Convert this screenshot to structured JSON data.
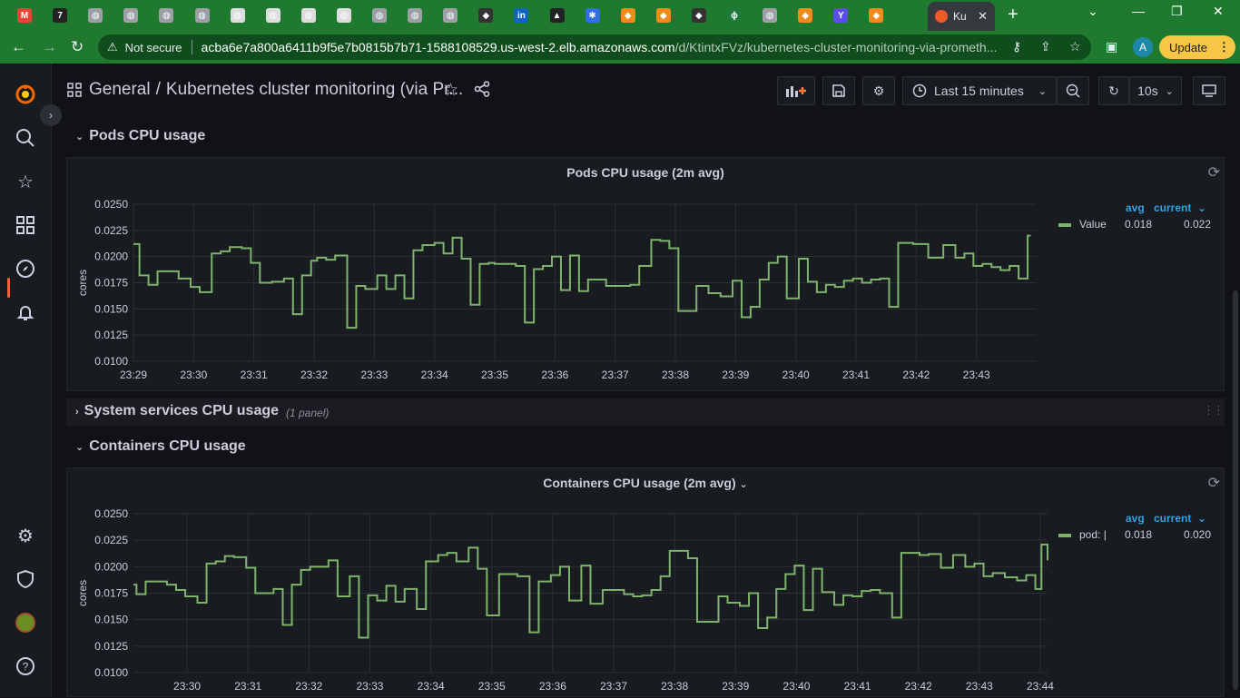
{
  "browser": {
    "tabs": [
      {
        "icon": "gmail-icon",
        "color": "#ea4335",
        "glyph": "M"
      },
      {
        "icon": "seven-icon",
        "color": "#222222",
        "glyph": "7"
      },
      {
        "icon": "globe-icon",
        "color": "#9aa0a6",
        "glyph": "◍"
      },
      {
        "icon": "globe-icon",
        "color": "#9aa0a6",
        "glyph": "◍"
      },
      {
        "icon": "globe-icon",
        "color": "#9aa0a6",
        "glyph": "◍"
      },
      {
        "icon": "globe-icon",
        "color": "#9aa0a6",
        "glyph": "◍"
      },
      {
        "icon": "globe-icon",
        "color": "#dddddd",
        "glyph": "◍"
      },
      {
        "icon": "globe-icon",
        "color": "#dddddd",
        "glyph": "◍"
      },
      {
        "icon": "globe-icon",
        "color": "#dddddd",
        "glyph": "◍"
      },
      {
        "icon": "globe-icon",
        "color": "#dddddd",
        "glyph": "◍"
      },
      {
        "icon": "globe-icon",
        "color": "#9aa0a6",
        "glyph": "◍"
      },
      {
        "icon": "globe-icon",
        "color": "#9aa0a6",
        "glyph": "◍"
      },
      {
        "icon": "globe-icon",
        "color": "#9aa0a6",
        "glyph": "◍"
      },
      {
        "icon": "cube-icon",
        "color": "#333333",
        "glyph": "◆"
      },
      {
        "icon": "linkedin-icon",
        "color": "#0a66c2",
        "glyph": "in"
      },
      {
        "icon": "grad-cap-icon",
        "color": "#222222",
        "glyph": "▲"
      },
      {
        "icon": "gear-logo-icon",
        "color": "#2f6fdf",
        "glyph": "✱"
      },
      {
        "icon": "aws-orange-icon",
        "color": "#f08c1a",
        "glyph": "◆"
      },
      {
        "icon": "aws-orange-icon",
        "color": "#f08c1a",
        "glyph": "◆"
      },
      {
        "icon": "cube-icon",
        "color": "#333333",
        "glyph": "◆"
      },
      {
        "icon": "leaf-icon",
        "color": "#1d7a3a",
        "glyph": "ϕ"
      },
      {
        "icon": "globe-icon",
        "color": "#9aa0a6",
        "glyph": "◍"
      },
      {
        "icon": "aws-orange-icon",
        "color": "#f08c1a",
        "glyph": "◆"
      },
      {
        "icon": "terraform-icon",
        "color": "#5c4ee5",
        "glyph": "Y"
      },
      {
        "icon": "aws-orange-icon",
        "color": "#f08c1a",
        "glyph": "◆"
      }
    ],
    "active_tab_title": "Ku",
    "not_secure": "Not secure",
    "url_host": "acba6e7a800a6411b9f5e7b0815b7b71-1588108529.us-west-2.elb.amazonaws.com",
    "url_path": "/d/KtintxFVz/kubernetes-cluster-monitoring-via-prometh...",
    "profile_letter": "A",
    "update_label": "Update"
  },
  "dashboard": {
    "folder": "General",
    "title": "Kubernetes cluster monitoring (via Pr...",
    "time_range": "Last 15 minutes",
    "refresh_interval": "10s"
  },
  "rows": {
    "pods": "Pods CPU usage",
    "system": "System services CPU usage",
    "system_meta": "(1 panel)",
    "containers": "Containers CPU usage"
  },
  "panels": {
    "pods": {
      "title": "Pods CPU usage (2m avg)",
      "legend_headers": {
        "avg": "avg",
        "current": "current"
      },
      "legend": {
        "name": "Value",
        "avg": "0.018",
        "current": "0.022"
      }
    },
    "containers": {
      "title": "Containers CPU usage (2m avg)",
      "legend_headers": {
        "avg": "avg",
        "current": "current"
      },
      "legend": {
        "name": "pod: |",
        "avg": "0.018",
        "current": "0.020"
      }
    }
  },
  "chart_data": [
    {
      "type": "line",
      "title": "Pods CPU usage (2m avg)",
      "ylabel": "cores",
      "xlabel": "",
      "ylim": [
        0.01,
        0.025
      ],
      "xlim": [
        0,
        15
      ],
      "yticks": [
        "0.0250",
        "0.0225",
        "0.0200",
        "0.0175",
        "0.0150",
        "0.0125",
        "0.0100"
      ],
      "xticks": [
        "23:29",
        "23:30",
        "23:31",
        "23:32",
        "23:33",
        "23:34",
        "23:35",
        "23:36",
        "23:37",
        "23:38",
        "23:39",
        "23:40",
        "23:41",
        "23:42",
        "23:43"
      ],
      "xtick_pos": [
        0,
        1,
        2,
        3,
        4,
        5,
        6,
        7,
        8,
        9,
        10,
        11,
        12,
        13,
        14
      ],
      "grid": true,
      "legend_position": "right",
      "color": "#7eb26d",
      "series": [
        {
          "name": "Value",
          "x": [
            0,
            0.1,
            0.25,
            0.4,
            0.55,
            0.75,
            0.95,
            1.1,
            1.3,
            1.45,
            1.6,
            1.8,
            1.95,
            2.1,
            2.3,
            2.5,
            2.65,
            2.8,
            2.95,
            3.05,
            3.2,
            3.35,
            3.55,
            3.7,
            3.85,
            4.05,
            4.2,
            4.35,
            4.5,
            4.65,
            4.8,
            5.0,
            5.15,
            5.3,
            5.45,
            5.6,
            5.75,
            5.9,
            6.0,
            6.1,
            6.2,
            6.35,
            6.5,
            6.65,
            6.8,
            6.95,
            7.1,
            7.25,
            7.4,
            7.55,
            7.7,
            7.85,
            8.05,
            8.25,
            8.4,
            8.6,
            8.75,
            8.9,
            9.05,
            9.2,
            9.35,
            9.55,
            9.75,
            9.95,
            10.1,
            10.25,
            10.4,
            10.55,
            10.7,
            10.85,
            11.05,
            11.2,
            11.35,
            11.5,
            11.65,
            11.8,
            11.95,
            12.1,
            12.25,
            12.4,
            12.55,
            12.7,
            12.85,
            12.95,
            13.05,
            13.2,
            13.45,
            13.65,
            13.8,
            13.95,
            14.1,
            14.25,
            14.4,
            14.55,
            14.7,
            14.85,
            14.9
          ],
          "values": [
            0.0212,
            0.0182,
            0.0173,
            0.0186,
            0.0186,
            0.0179,
            0.0171,
            0.0166,
            0.0203,
            0.0205,
            0.0209,
            0.0208,
            0.0194,
            0.0175,
            0.0176,
            0.0179,
            0.0145,
            0.0182,
            0.0196,
            0.0199,
            0.0197,
            0.0201,
            0.0132,
            0.0172,
            0.0169,
            0.0182,
            0.0169,
            0.0182,
            0.016,
            0.0206,
            0.0211,
            0.0213,
            0.0203,
            0.0218,
            0.0198,
            0.0154,
            0.0193,
            0.0194,
            0.0193,
            0.0193,
            0.0193,
            0.0191,
            0.0137,
            0.0188,
            0.0191,
            0.02,
            0.0168,
            0.0201,
            0.0167,
            0.0178,
            0.0178,
            0.0172,
            0.0172,
            0.0173,
            0.0191,
            0.0216,
            0.0215,
            0.0208,
            0.0148,
            0.0148,
            0.0172,
            0.0165,
            0.0162,
            0.0177,
            0.0142,
            0.0152,
            0.0178,
            0.0194,
            0.02,
            0.016,
            0.0198,
            0.0176,
            0.0166,
            0.0173,
            0.0171,
            0.0177,
            0.0179,
            0.0175,
            0.0178,
            0.0179,
            0.0152,
            0.0213,
            0.0213,
            0.0212,
            0.0212,
            0.0199,
            0.0211,
            0.0199,
            0.0203,
            0.0191,
            0.0193,
            0.019,
            0.0187,
            0.0191,
            0.0179,
            0.022,
            0.022
          ]
        }
      ]
    },
    {
      "type": "line",
      "title": "Containers CPU usage (2m avg)",
      "ylabel": "cores",
      "xlabel": "",
      "ylim": [
        0.01,
        0.025
      ],
      "xlim": [
        0,
        15
      ],
      "yticks": [
        "0.0250",
        "0.0225",
        "0.0200",
        "0.0175",
        "0.0150",
        "0.0125",
        "0.0100"
      ],
      "xticks": [
        "23:30",
        "23:31",
        "23:32",
        "23:33",
        "23:34",
        "23:35",
        "23:36",
        "23:37",
        "23:38",
        "23:39",
        "23:40",
        "23:41",
        "23:42",
        "23:43",
        "23:44"
      ],
      "xtick_pos": [
        0.88,
        1.88,
        2.88,
        3.88,
        4.88,
        5.88,
        6.88,
        7.88,
        8.88,
        9.88,
        10.88,
        11.88,
        12.88,
        13.88,
        14.88
      ],
      "grid": true,
      "legend_position": "right",
      "color": "#7eb26d",
      "series": [
        {
          "name": "pod: |",
          "x": [
            0,
            0.05,
            0.2,
            0.4,
            0.55,
            0.7,
            0.85,
            1.05,
            1.2,
            1.35,
            1.5,
            1.65,
            1.85,
            2.0,
            2.15,
            2.3,
            2.45,
            2.6,
            2.75,
            2.9,
            3.05,
            3.2,
            3.35,
            3.55,
            3.7,
            3.85,
            4.0,
            4.15,
            4.3,
            4.45,
            4.65,
            4.8,
            5.0,
            5.15,
            5.3,
            5.5,
            5.65,
            5.8,
            6.0,
            6.15,
            6.3,
            6.5,
            6.65,
            6.85,
            7.0,
            7.15,
            7.35,
            7.5,
            7.7,
            7.85,
            8.05,
            8.2,
            8.35,
            8.5,
            8.65,
            8.8,
            8.95,
            9.1,
            9.25,
            9.45,
            9.6,
            9.75,
            9.95,
            10.1,
            10.25,
            10.4,
            10.55,
            10.7,
            10.85,
            11.0,
            11.15,
            11.3,
            11.5,
            11.65,
            11.8,
            11.95,
            12.1,
            12.25,
            12.45,
            12.6,
            12.75,
            12.9,
            13.05,
            13.25,
            13.45,
            13.65,
            13.8,
            13.95,
            14.1,
            14.3,
            14.5,
            14.65,
            14.8,
            14.9,
            15.0
          ],
          "values": [
            0.0183,
            0.0174,
            0.0186,
            0.0186,
            0.0183,
            0.0178,
            0.0172,
            0.0166,
            0.0203,
            0.0205,
            0.021,
            0.0209,
            0.0199,
            0.0175,
            0.0175,
            0.0179,
            0.0145,
            0.0183,
            0.0197,
            0.02,
            0.02,
            0.0206,
            0.0172,
            0.0191,
            0.0133,
            0.0173,
            0.0168,
            0.0182,
            0.0167,
            0.0179,
            0.016,
            0.0205,
            0.0211,
            0.0213,
            0.0205,
            0.0218,
            0.0198,
            0.0154,
            0.0193,
            0.0193,
            0.0191,
            0.0138,
            0.0186,
            0.0192,
            0.02,
            0.0168,
            0.0201,
            0.0165,
            0.0178,
            0.0178,
            0.0174,
            0.0172,
            0.0173,
            0.0178,
            0.0191,
            0.0215,
            0.0215,
            0.0208,
            0.0148,
            0.0148,
            0.0172,
            0.0166,
            0.0163,
            0.0175,
            0.0142,
            0.0152,
            0.0179,
            0.0193,
            0.0201,
            0.0159,
            0.0198,
            0.0176,
            0.0164,
            0.0173,
            0.0172,
            0.0177,
            0.0178,
            0.0175,
            0.0152,
            0.0213,
            0.0213,
            0.0211,
            0.0212,
            0.0199,
            0.0211,
            0.02,
            0.0203,
            0.0191,
            0.0194,
            0.019,
            0.0187,
            0.0192,
            0.0179,
            0.0221,
            0.0206
          ]
        }
      ]
    }
  ]
}
